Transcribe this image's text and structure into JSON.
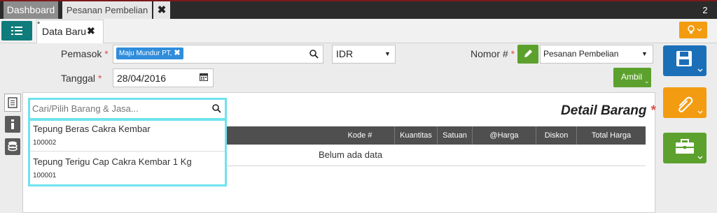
{
  "tabs": {
    "dashboard": "Dashboard",
    "pesanan": "Pesanan Pembelian",
    "close": "✖",
    "count": "2"
  },
  "doc_tab": {
    "star": "*",
    "label": "Data Baru",
    "close": "✖"
  },
  "form": {
    "pemasok_label": "Pemasok",
    "required_mark": "*",
    "pemasok_tag": "Maju Mundur PT,",
    "currency": "IDR",
    "nomor_label": "Nomor #",
    "nomor_type": "Pesanan Pembelian",
    "tanggal_label": "Tanggal",
    "tanggal_value": "28/04/2016",
    "ambil_label": "Ambil"
  },
  "search": {
    "placeholder": "Cari/Pilih Barang & Jasa..."
  },
  "detail": {
    "title": "Detail Barang",
    "columns": [
      "Kode #",
      "Kuantitas",
      "Satuan",
      "@Harga",
      "Diskon",
      "Total Harga"
    ],
    "empty_text": "Belum ada data"
  },
  "suggestions": [
    {
      "name": "Tepung Beras Cakra Kembar",
      "code": "100002"
    },
    {
      "name": "Tepung Terigu Cap Cakra Kembar 1 Kg",
      "code": "100001"
    }
  ],
  "colors": {
    "teal": "#0f7b7b",
    "green": "#5ca12d",
    "orange": "#f39c12",
    "blue": "#1a6fb8",
    "highlight": "#6ee3ee"
  }
}
